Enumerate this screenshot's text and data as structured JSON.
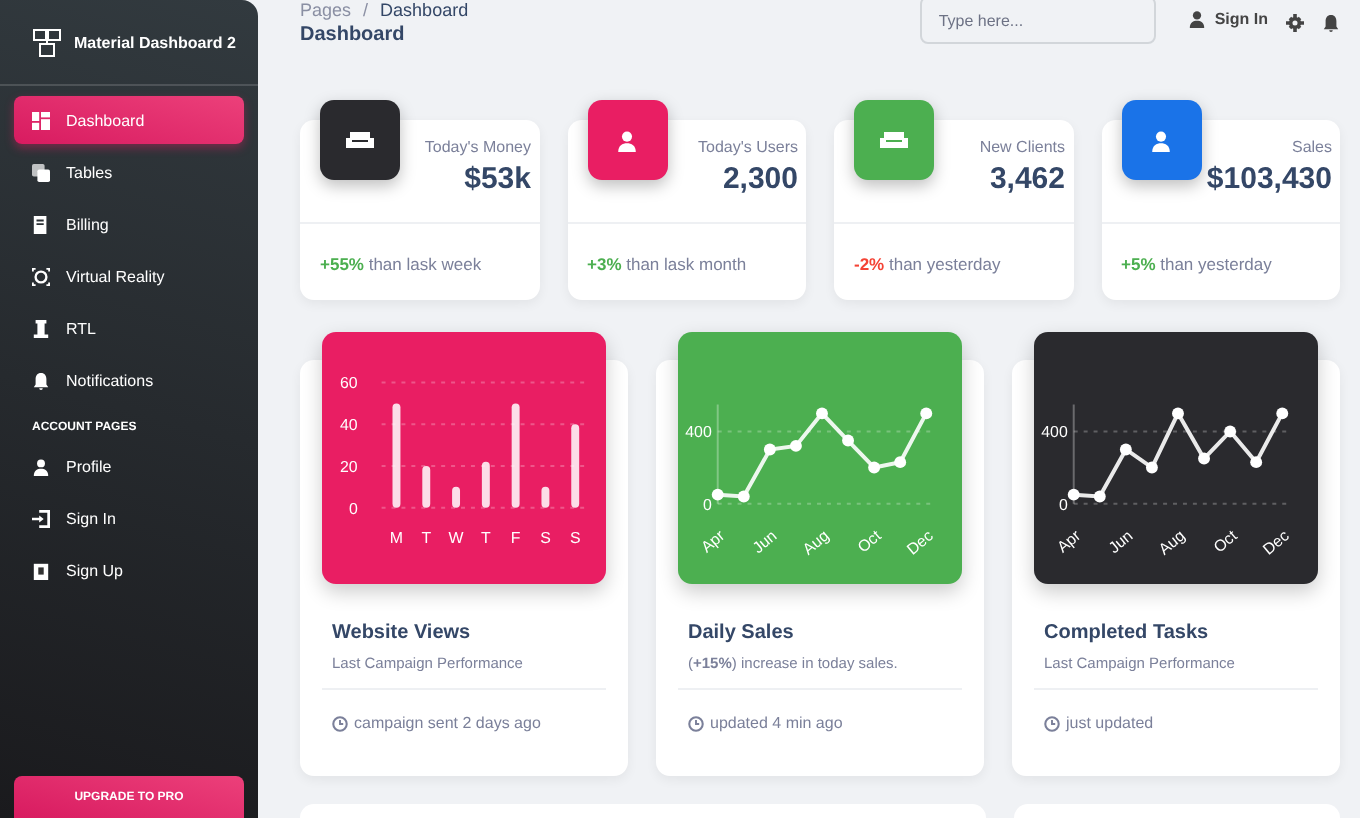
{
  "sidebar": {
    "brand": "Material Dashboard 2",
    "items": [
      {
        "label": "Dashboard",
        "selected": true
      },
      {
        "label": "Tables",
        "selected": false
      },
      {
        "label": "Billing",
        "selected": false
      },
      {
        "label": "Virtual Reality",
        "selected": false
      },
      {
        "label": "RTL",
        "selected": false
      },
      {
        "label": "Notifications",
        "selected": false
      }
    ],
    "section_title": "ACCOUNT PAGES",
    "account_items": [
      {
        "label": "Profile",
        "selected": false
      },
      {
        "label": "Sign In",
        "selected": false
      },
      {
        "label": "Sign Up",
        "selected": false
      }
    ],
    "upgrade_button": "UPGRADE TO PRO"
  },
  "header": {
    "breadcrumb": {
      "parent": "Pages",
      "separator": "/",
      "current": "Dashboard"
    },
    "title": "Dashboard",
    "search": {
      "placeholder": "Type here..."
    },
    "sign_in": "Sign In"
  },
  "stats": [
    {
      "label": "Today's Money",
      "value": "$53k",
      "change": "+55%",
      "negative": false,
      "note": "than lask week",
      "color": "#2a2a2e"
    },
    {
      "label": "Today's Users",
      "value": "2,300",
      "change": "+3%",
      "negative": false,
      "note": "than lask month",
      "color": "#e91e63"
    },
    {
      "label": "New Clients",
      "value": "3,462",
      "change": "-2%",
      "negative": true,
      "note": "than yesterday",
      "color": "#4caf50"
    },
    {
      "label": "Sales",
      "value": "$103,430",
      "change": "+5%",
      "negative": false,
      "note": "than yesterday",
      "color": "#1a73e8"
    }
  ],
  "chart_cards": [
    {
      "title": "Website Views",
      "subtitle": "Last Campaign Performance",
      "footer": "campaign sent 2 days ago",
      "color": "#e91e63",
      "chart_data": {
        "type": "bar",
        "categories": [
          "M",
          "T",
          "W",
          "T",
          "F",
          "S",
          "S"
        ],
        "values": [
          50,
          20,
          10,
          22,
          50,
          10,
          40
        ],
        "ylim": [
          0,
          60
        ],
        "yticks": [
          0,
          20,
          40,
          60
        ]
      }
    },
    {
      "title": "Daily Sales",
      "subtitle": "(**+15%**) increase in today sales.",
      "footer": "updated 4 min ago",
      "color": "#4caf50",
      "chart_data": {
        "type": "line",
        "categories": [
          "Apr",
          null,
          "Jun",
          null,
          "Aug",
          null,
          "Oct",
          null,
          "Dec"
        ],
        "values": [
          50,
          40,
          300,
          320,
          500,
          350,
          200,
          230,
          500
        ],
        "marker": true,
        "ylim": [
          0,
          550
        ],
        "yticks": [
          0,
          400
        ]
      }
    },
    {
      "title": "Completed Tasks",
      "subtitle": "Last Campaign Performance",
      "footer": "just updated",
      "color": "#2a2a2e",
      "chart_data": {
        "type": "line",
        "categories": [
          "Apr",
          null,
          "Jun",
          null,
          "Aug",
          null,
          "Oct",
          null,
          "Dec"
        ],
        "values": [
          50,
          40,
          300,
          200,
          500,
          250,
          400,
          230,
          500
        ],
        "marker": true,
        "ylim": [
          0,
          550
        ],
        "yticks": [
          0,
          400
        ]
      }
    }
  ]
}
